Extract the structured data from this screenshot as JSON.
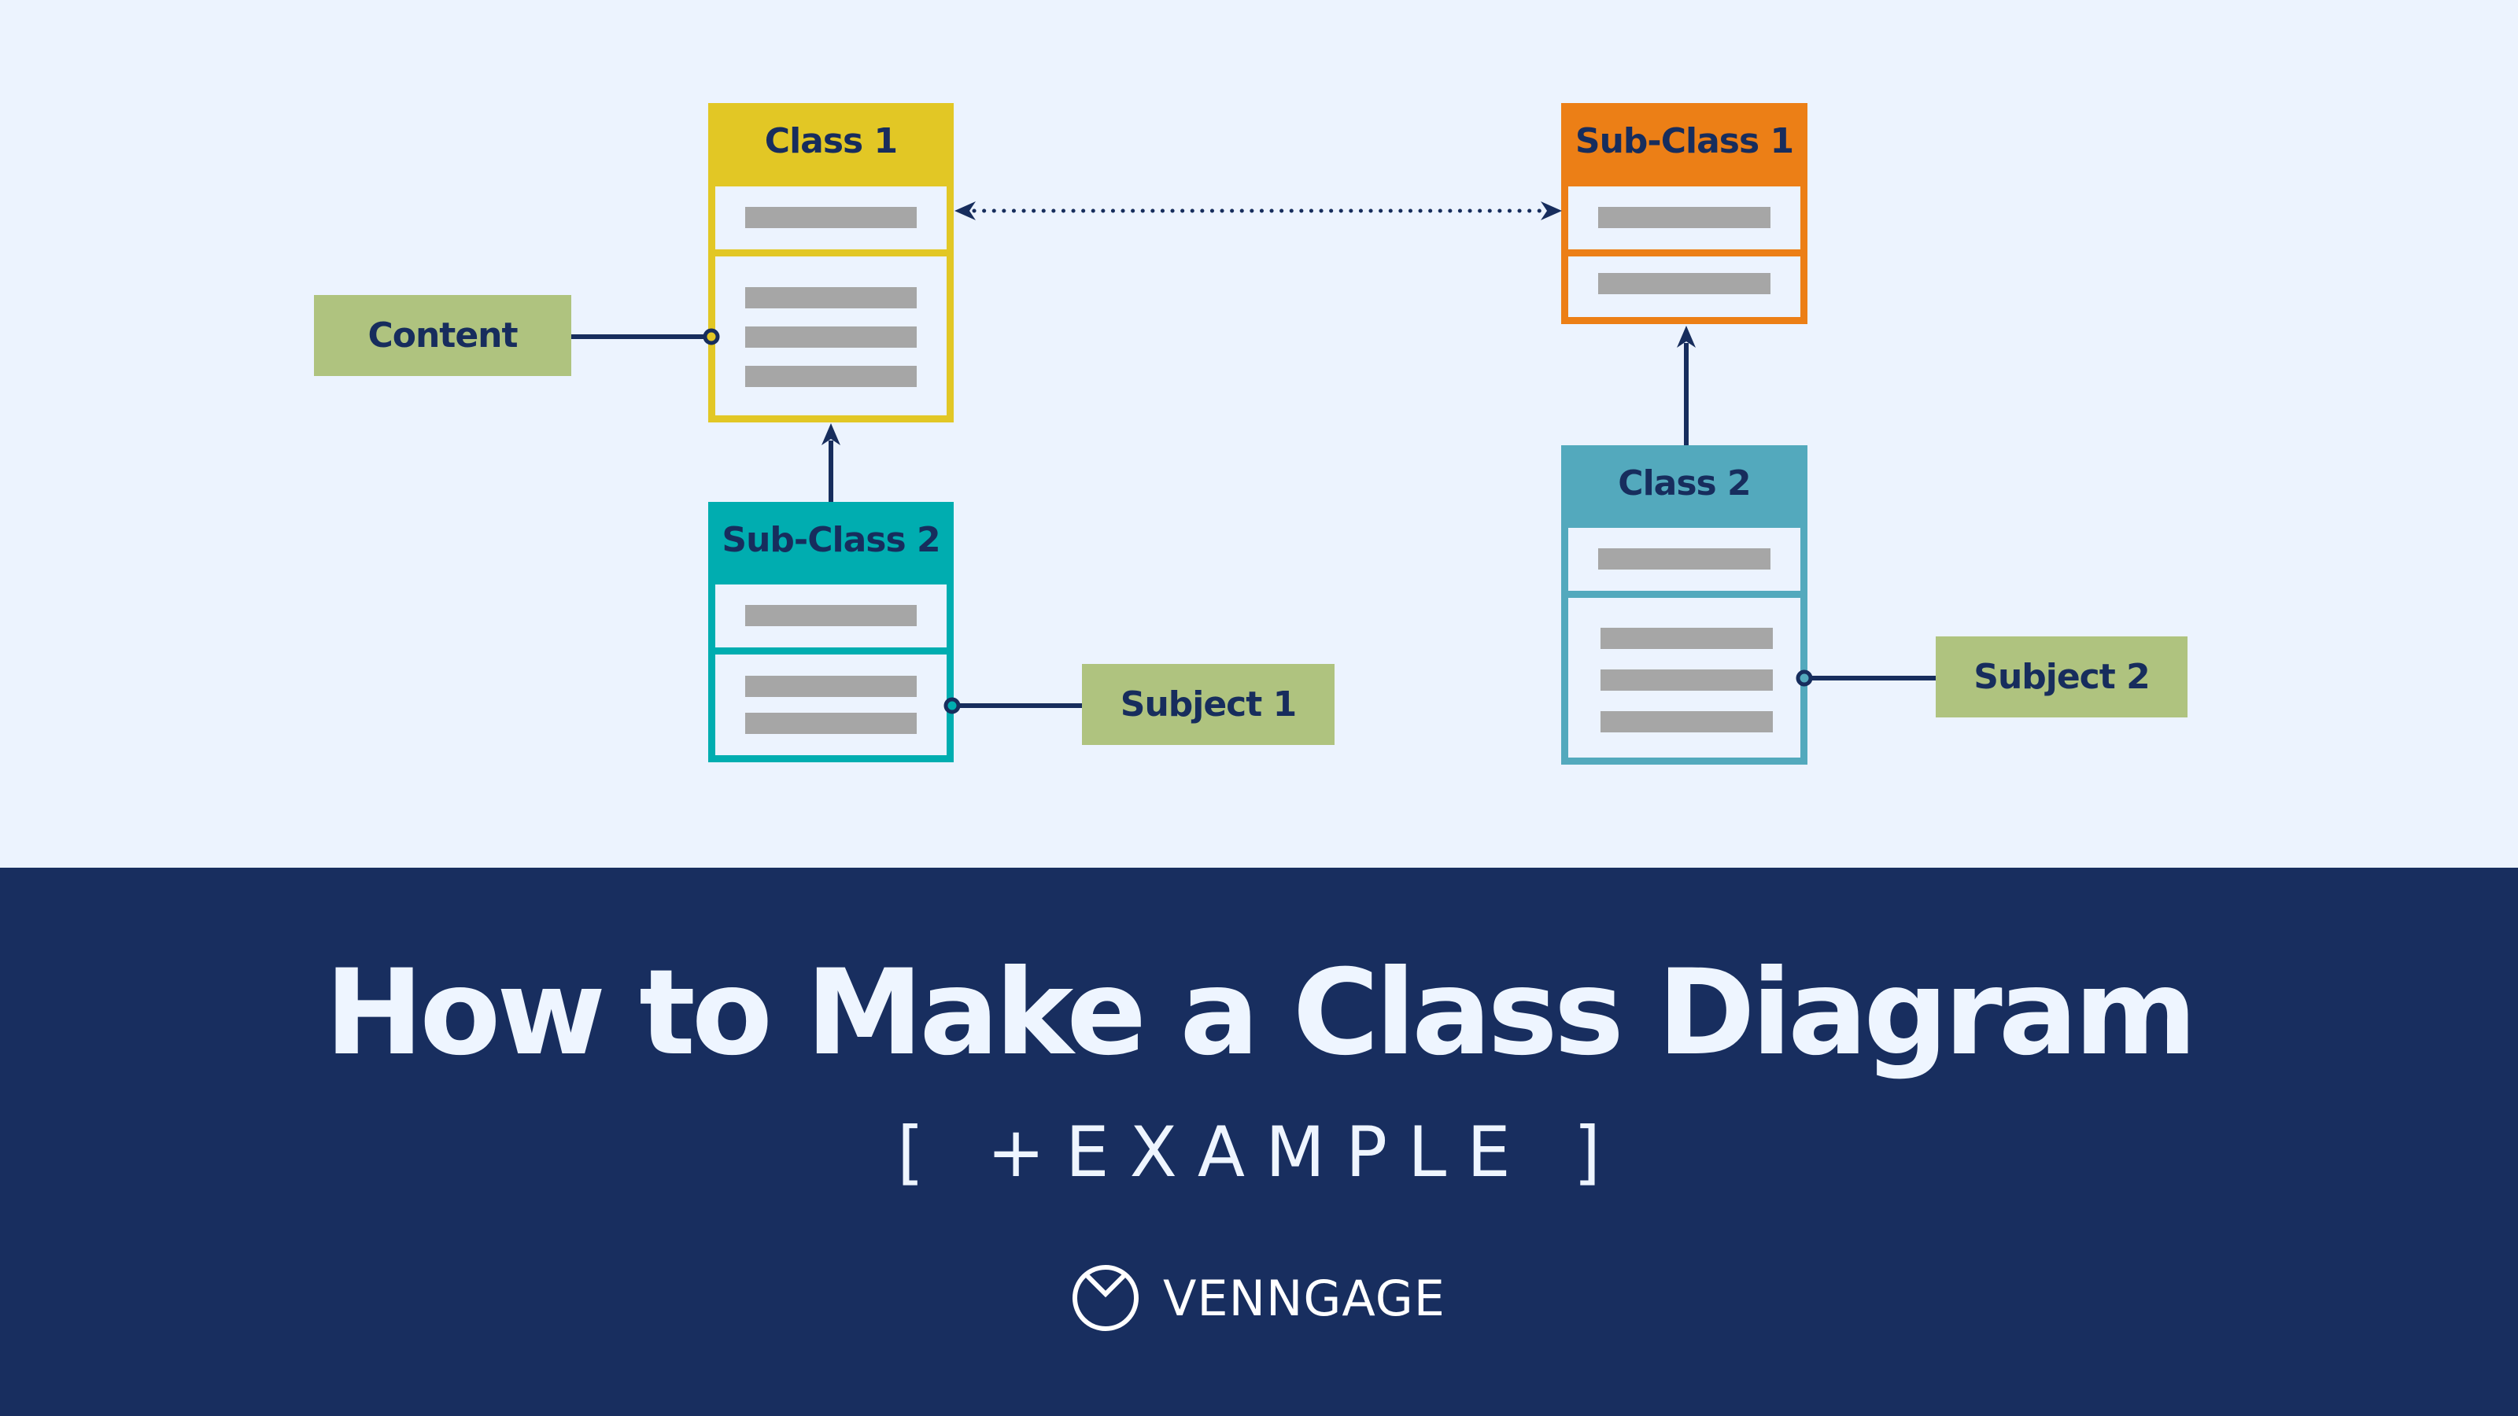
{
  "diagram": {
    "classes": [
      {
        "id": "class-1",
        "title": "Class 1",
        "color": "#e2c725",
        "attribute_rows": 1,
        "method_rows": 3
      },
      {
        "id": "sub-class-2",
        "title": "Sub-Class 2",
        "color": "#00adb0",
        "attribute_rows": 1,
        "method_rows": 2
      },
      {
        "id": "sub-class-1",
        "title": "Sub-Class 1",
        "color": "#ec7f16",
        "attribute_rows": 1,
        "method_rows": 1
      },
      {
        "id": "class-2",
        "title": "Class 2",
        "color": "#53a9bd",
        "attribute_rows": 1,
        "method_rows": 3
      }
    ],
    "labels": [
      {
        "id": "content",
        "text": "Content",
        "color": "#afc37f"
      },
      {
        "id": "subject-1",
        "text": "Subject 1",
        "color": "#afc37f"
      },
      {
        "id": "subject-2",
        "text": "Subject 2",
        "color": "#afc37f"
      }
    ],
    "relationships": [
      {
        "from": "sub-class-2",
        "to": "class-1",
        "type": "inheritance"
      },
      {
        "from": "class-2",
        "to": "sub-class-1",
        "type": "inheritance"
      },
      {
        "from": "class-1",
        "to": "sub-class-1",
        "type": "bidirectional-dotted"
      },
      {
        "from": "content",
        "to": "class-1",
        "type": "interface"
      },
      {
        "from": "subject-1",
        "to": "sub-class-2",
        "type": "interface"
      },
      {
        "from": "subject-2",
        "to": "class-2",
        "type": "interface"
      }
    ],
    "line_color": "#172d5d",
    "placeholder_color": "#a6a6a6"
  },
  "banner": {
    "title": "How to Make a Class Diagram",
    "subtitle": "[ +EXAMPLE ]",
    "background": "#182e5f",
    "text_color": "#eef5ff"
  },
  "brand": {
    "name": "VENNGAGE",
    "icon": "venngage-logo-icon"
  }
}
